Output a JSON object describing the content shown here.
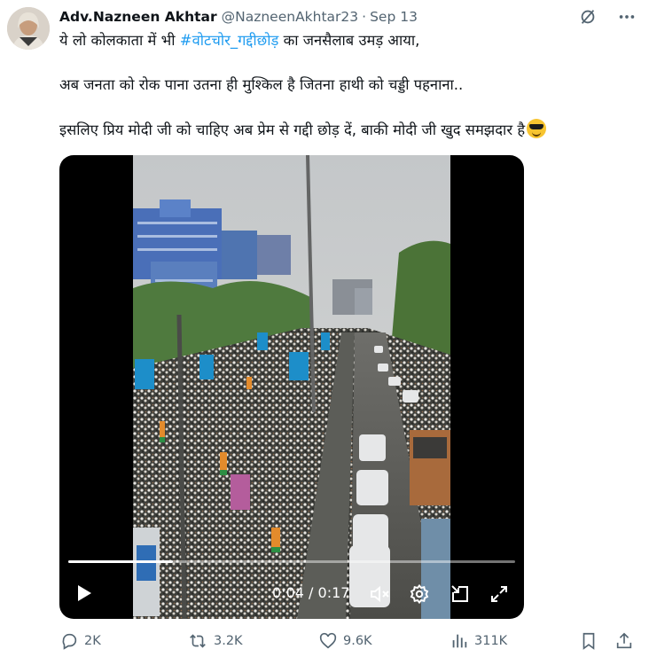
{
  "tweet": {
    "author_name": "Adv.Nazneen Akhtar",
    "handle": "@NazneenAkhtar23",
    "separator": "·",
    "date": "Sep 13",
    "line1_prefix": "ये लो कोलकाता में भी ",
    "hashtag": "#वोटचोर_गद्दीछोड़",
    "line1_suffix": " का  जनसैलाब उमड़ आया,",
    "line2": "अब जनता को रोक पाना उतना ही मुश्किल है जितना हाथी को चड्डी पहनाना..",
    "line3": "इसलिए प्रिय मोदी जी को चाहिए अब प्रेम से गद्दी छोड़ दें, बाकी मोदी जी खुद समझदार है",
    "emoji": "smiling-face-with-sunglasses"
  },
  "video": {
    "current_time": "0:04",
    "separator": "/",
    "duration": "0:17",
    "progress_fraction": 0.235
  },
  "actions": {
    "replies": "2K",
    "reposts": "3.2K",
    "likes": "9.6K",
    "views": "311K"
  },
  "icons": {
    "top": [
      "grok-icon",
      "more-icon"
    ],
    "video": [
      "play-icon",
      "mute-icon",
      "settings-icon",
      "pip-icon",
      "fullscreen-icon"
    ],
    "actions": [
      "reply-icon",
      "repost-icon",
      "like-icon",
      "views-icon",
      "bookmark-icon",
      "share-icon"
    ]
  },
  "colors": {
    "text": "#0f1419",
    "muted": "#536471",
    "link": "#1d9bf0"
  }
}
